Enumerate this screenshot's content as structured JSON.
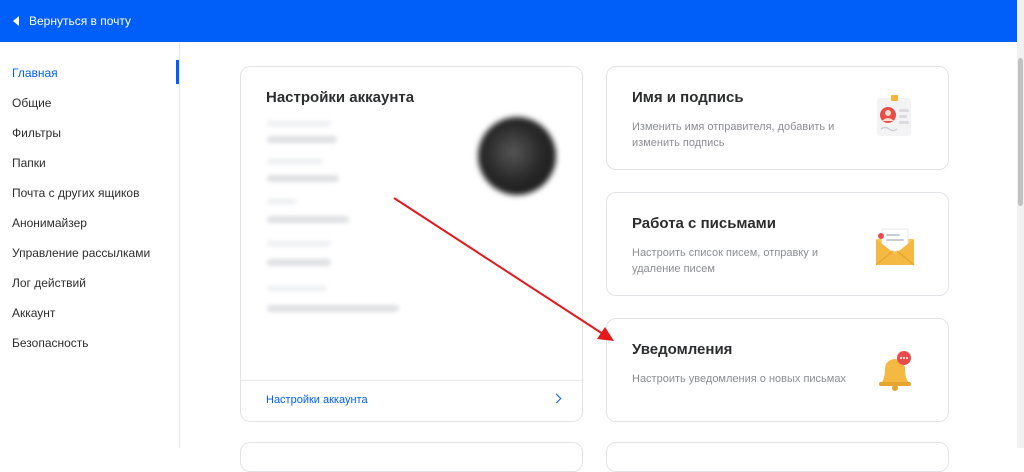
{
  "topbar": {
    "back_label": "Вернуться в почту"
  },
  "sidebar": {
    "items": [
      {
        "label": "Главная",
        "active": true
      },
      {
        "label": "Общие"
      },
      {
        "label": "Фильтры"
      },
      {
        "label": "Папки"
      },
      {
        "label": "Почта с других ящиков"
      },
      {
        "label": "Анонимайзер"
      },
      {
        "label": "Управление рассылками"
      },
      {
        "label": "Лог действий"
      },
      {
        "label": "Аккаунт"
      },
      {
        "label": "Безопасность"
      }
    ]
  },
  "account_card": {
    "title": "Настройки аккаунта",
    "link_label": "Настройки аккаунта"
  },
  "cards": [
    {
      "title": "Имя и подпись",
      "desc": "Изменить имя отправителя, добавить и изменить подпись",
      "icon": "id-card-icon"
    },
    {
      "title": "Работа с письмами",
      "desc": "Настроить список писем, отправку и удаление писем",
      "icon": "envelope-icon"
    },
    {
      "title": "Уведомления",
      "desc": "Настроить уведомления о новых письмах",
      "icon": "bell-icon"
    }
  ],
  "colors": {
    "accent": "#005ff9",
    "annotation_arrow": "#e3191e"
  }
}
